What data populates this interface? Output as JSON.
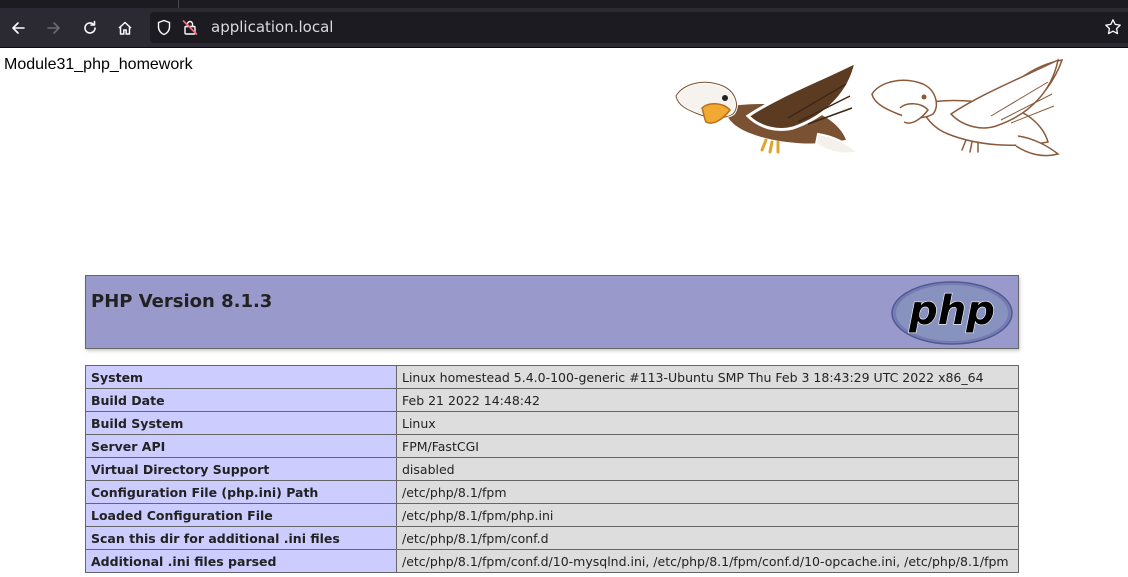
{
  "browser": {
    "url": "application.local",
    "icons": [
      "back-arrow-icon",
      "forward-arrow-icon",
      "reload-icon",
      "home-icon",
      "shield-icon",
      "insecure-lock-icon",
      "bookmark-star-icon"
    ]
  },
  "page": {
    "header_text": "Module31_php_homework",
    "php_version_title": "PHP Version 8.1.3",
    "php_logo_text": "php"
  },
  "info_rows": [
    {
      "key": "System",
      "value": "Linux homestead 5.4.0-100-generic #113-Ubuntu SMP Thu Feb 3 18:43:29 UTC 2022 x86_64"
    },
    {
      "key": "Build Date",
      "value": "Feb 21 2022 14:48:42"
    },
    {
      "key": "Build System",
      "value": "Linux"
    },
    {
      "key": "Server API",
      "value": "FPM/FastCGI"
    },
    {
      "key": "Virtual Directory Support",
      "value": "disabled"
    },
    {
      "key": "Configuration File (php.ini) Path",
      "value": "/etc/php/8.1/fpm"
    },
    {
      "key": "Loaded Configuration File",
      "value": "/etc/php/8.1/fpm/php.ini"
    },
    {
      "key": "Scan this dir for additional .ini files",
      "value": "/etc/php/8.1/fpm/conf.d"
    },
    {
      "key": "Additional .ini files parsed",
      "value": "/etc/php/8.1/fpm/conf.d/10-mysqlnd.ini, /etc/php/8.1/fpm/conf.d/10-opcache.ini, /etc/php/8.1/fpm"
    }
  ],
  "colors": {
    "toolbar": "#2b2a33",
    "php_header": "#9999cc",
    "key_cell": "#ccccff",
    "value_cell": "#dddddd"
  }
}
